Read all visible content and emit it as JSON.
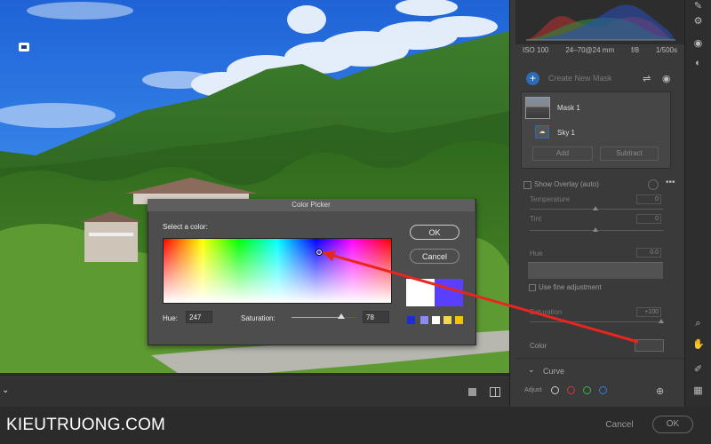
{
  "photo": {
    "description_icon": "image-badge-icon"
  },
  "histogram_panel": {
    "iso": "ISO 100",
    "lens": "24–70@24 mm",
    "aperture": "f/8",
    "shutter": "1/500s"
  },
  "mask_panel": {
    "create_label": "Create New Mask",
    "masks": [
      {
        "label": "Mask 1"
      },
      {
        "label": "Sky 1"
      }
    ],
    "add_label": "Add",
    "subtract_label": "Subtract",
    "show_overlay_label": "Show Overlay (auto)"
  },
  "adjustments": {
    "temperature_label": "Temperature",
    "temperature_value": "0",
    "tint_label": "Tint",
    "tint_value": "0",
    "hue_label": "Hue",
    "hue_value": "0.0",
    "fine_label": "Use fine adjustment",
    "saturation_label": "Saturation",
    "saturation_value": "+100",
    "color_label": "Color"
  },
  "curve": {
    "label": "Curve",
    "adjust_label": "Adjust",
    "channels": [
      {
        "name": "rgb",
        "color": "#cccccc"
      },
      {
        "name": "red",
        "color": "#d23a3a"
      },
      {
        "name": "green",
        "color": "#35b54a"
      },
      {
        "name": "blue",
        "color": "#2f7de1"
      }
    ]
  },
  "color_picker": {
    "title": "Color Picker",
    "select_label": "Select a color:",
    "hue_label": "Hue:",
    "hue_value": "247",
    "saturation_label": "Saturation:",
    "saturation_value": "78",
    "ok_label": "OK",
    "cancel_label": "Cancel",
    "old_color": "#ffffff",
    "new_color": "#5a3fff",
    "swatches": [
      "#1f2bd6",
      "#8c8cf0",
      "#ffffff",
      "#f2d84a",
      "#f5c400"
    ]
  },
  "footer": {
    "watermark": "KIEUTRUONG.COM",
    "cancel_label": "Cancel",
    "ok_label": "OK"
  },
  "annotation": {
    "color": "#e8261f"
  }
}
